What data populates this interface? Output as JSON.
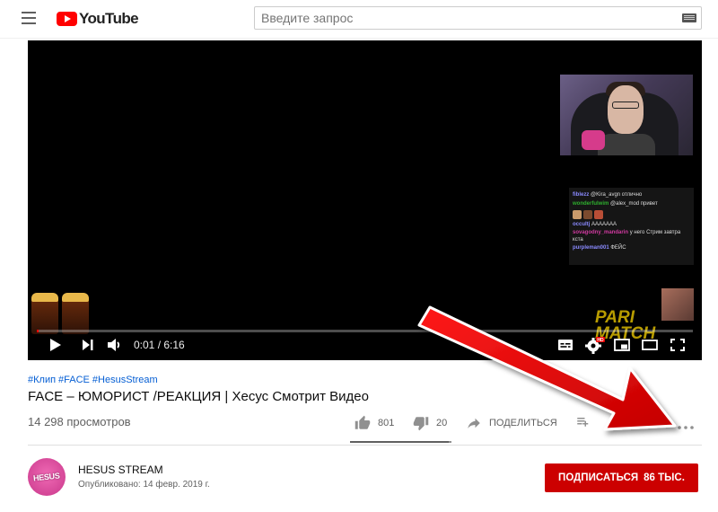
{
  "masthead": {
    "logo_text": "YouTube",
    "search_placeholder": "Введите запрос"
  },
  "player": {
    "time_display": "0:01 / 6:16",
    "progress": 0.003,
    "sponsor_text": "PARI MATCH",
    "chat_messages": [
      {
        "user": "fiblezz",
        "text": "@Kira_avgn отлично",
        "user_color": "#8a8aff"
      },
      {
        "user": "wonderfulwim",
        "text": "@alex_mod привет",
        "user_color": "#2eaf2e"
      },
      {
        "user": "occultj",
        "text": "ААААААА",
        "user_color": "#8a8aff"
      },
      {
        "user": "sovagodny_mandarin",
        "text": "у него Стрим завтра кста",
        "user_color": "#d03aa0"
      },
      {
        "user": "purpleman001",
        "text": "ФЕЙС",
        "user_color": "#8a8aff"
      }
    ]
  },
  "video": {
    "tags": [
      "#Клип",
      "#FACE",
      "#HesusStream"
    ],
    "title": "FACE – ЮМОРИСТ /РЕАКЦИЯ | Хесус Смотрит Видео",
    "views": "14 298 просмотров",
    "likes": "801",
    "dislikes": "20",
    "share_label": "ПОДЕЛИТЬСЯ",
    "like_ratio": 0.976
  },
  "channel": {
    "avatar_text": "HESUS",
    "name": "HESUS STREAM",
    "published": "Опубликовано: 14 февр. 2019 г.",
    "subscribe_label": "ПОДПИСАТЬСЯ",
    "subscriber_count": "86 ТЫС."
  },
  "colors": {
    "brand_red": "#ff0000",
    "subscribe_red": "#cc0000",
    "link_blue": "#065fd4",
    "annotation_arrow": "#e00000"
  },
  "icons": [
    "menu-icon",
    "keyboard-icon",
    "play-icon",
    "next-icon",
    "volume-icon",
    "subtitles-icon",
    "settings-icon",
    "miniplayer-icon",
    "theater-icon",
    "fullscreen-icon",
    "like-icon",
    "dislike-icon",
    "share-icon",
    "add-to-playlist-icon",
    "more-icon"
  ]
}
